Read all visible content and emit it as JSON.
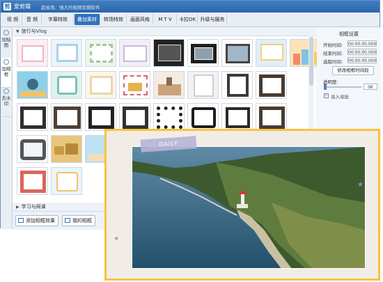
{
  "app": {
    "name": "爱剪辑",
    "slogan": "超易用、强大的视频剪辑软件"
  },
  "menu": {
    "tabs": [
      {
        "label": "视  频"
      },
      {
        "label": "音  频"
      },
      {
        "label": "字幕特效"
      },
      {
        "label": "叠加素材",
        "active": true
      },
      {
        "label": "转场特效"
      },
      {
        "label": "画面风格"
      },
      {
        "label": "M T V"
      },
      {
        "label": "卡拉OK"
      },
      {
        "label": "升级与服务"
      }
    ]
  },
  "sidebar": {
    "tabs": [
      {
        "label": "加贴图"
      },
      {
        "label": "加相框",
        "active": true
      },
      {
        "label": "去水印"
      }
    ]
  },
  "sections": {
    "travel": "旅行与Vlog",
    "study": "学习与网课"
  },
  "buttons": {
    "add_frame": "添加相框效果",
    "my_frames": "我的相框"
  },
  "frame_settings": {
    "title": "相框设置",
    "start_label": "开始时间:",
    "start_value": "00:00:00.000",
    "end_label": "结束时间:",
    "end_value": "00:00:00.000",
    "duration_label": "选取时间:",
    "duration_value": "00:00:00.000",
    "modify_button": "修改相框时间段",
    "opacity_label": "透明度:",
    "opacity_value": "0K",
    "fade_label": "淡入淡出",
    "fade_checked": true
  },
  "overlay": {
    "tape_text": "DAILY"
  }
}
